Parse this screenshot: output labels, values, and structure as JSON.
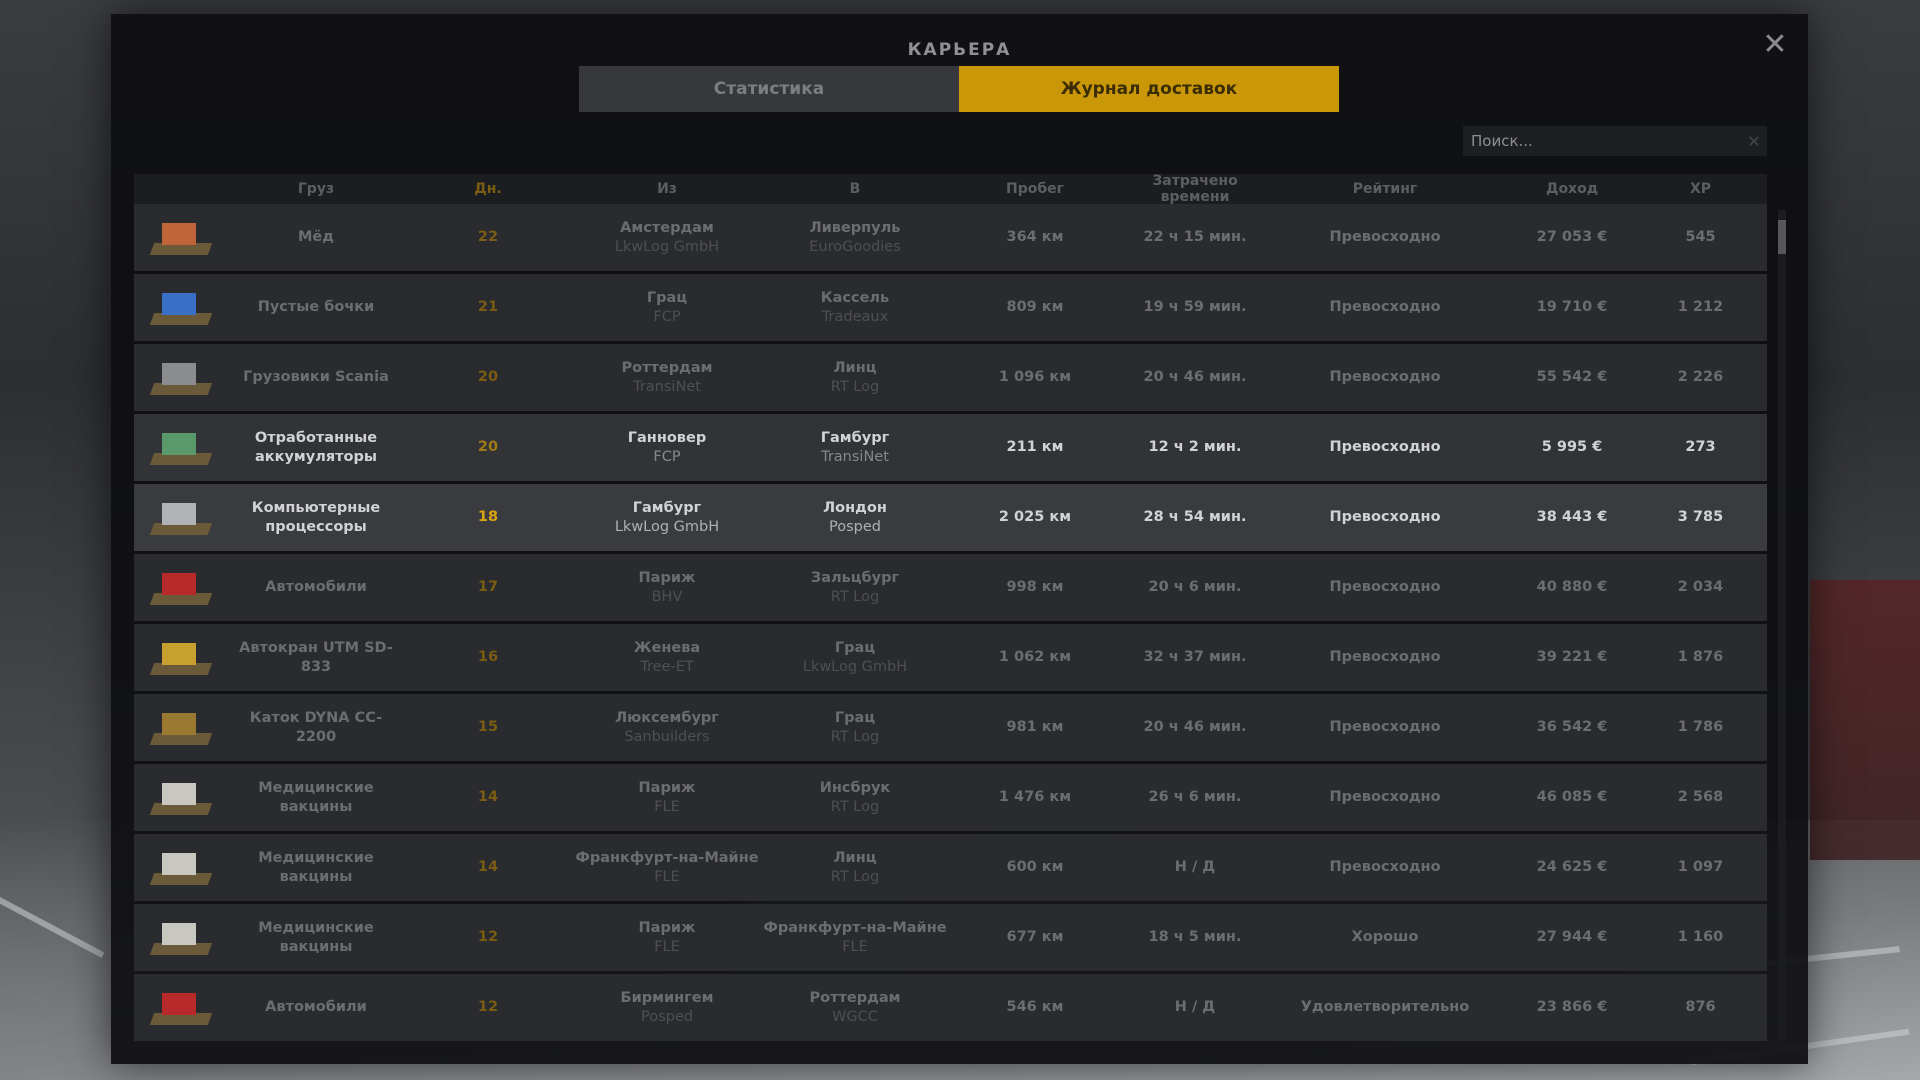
{
  "window": {
    "title": "КАРЬЕРА",
    "close_glyph": "✕"
  },
  "tabs": [
    {
      "label": "Статистика",
      "active": false
    },
    {
      "label": "Журнал доставок",
      "active": true
    }
  ],
  "search": {
    "placeholder": "Поиск...",
    "value": "",
    "clear_glyph": "✕"
  },
  "colors": {
    "accent": "#c99707",
    "days": "#d9a410",
    "panel": "#0e0e10"
  },
  "columns": [
    "Груз",
    "Дн.",
    "Из",
    "В",
    "Пробег",
    "Затрачено времени",
    "Рейтинг",
    "Доход",
    "XP"
  ],
  "rows": [
    {
      "icon": "honey-cargo-icon",
      "icon_color": "#c0653a",
      "cargo": "Мёд",
      "days": "22",
      "from_city": "Амстердам",
      "from_company": "LkwLog GmbH",
      "to_city": "Ливерпуль",
      "to_company": "EuroGoodies",
      "distance": "364 км",
      "time": "22 ч 15 мин.",
      "rating": "Превосходно",
      "income": "27 053 €",
      "xp": "545"
    },
    {
      "icon": "barrels-cargo-icon",
      "icon_color": "#3a6fc8",
      "cargo": "Пустые бочки",
      "days": "21",
      "from_city": "Грац",
      "from_company": "FCP",
      "to_city": "Кассель",
      "to_company": "Tradeaux",
      "distance": "809 км",
      "time": "19 ч 59 мин.",
      "rating": "Превосходно",
      "income": "19 710 €",
      "xp": "1 212"
    },
    {
      "icon": "truck-cargo-icon",
      "icon_color": "#8a8c90",
      "cargo": "Грузовики Scania",
      "days": "20",
      "from_city": "Роттердам",
      "from_company": "TransiNet",
      "to_city": "Линц",
      "to_company": "RT Log",
      "distance": "1 096 км",
      "time": "20 ч 46 мин.",
      "rating": "Превосходно",
      "income": "55 542 €",
      "xp": "2 226"
    },
    {
      "icon": "battery-cargo-icon",
      "icon_color": "#5a9a6a",
      "cargo": "Отработанные аккумуляторы",
      "days": "20",
      "from_city": "Ганновер",
      "from_company": "FCP",
      "to_city": "Гамбург",
      "to_company": "TransiNet",
      "distance": "211 км",
      "time": "12 ч 2 мин.",
      "rating": "Превосходно",
      "income": "5 995 €",
      "xp": "273"
    },
    {
      "icon": "computer-cargo-icon",
      "icon_color": "#b0b2b6",
      "cargo": "Компьютерные процессоры",
      "days": "18",
      "from_city": "Гамбург",
      "from_company": "LkwLog GmbH",
      "to_city": "Лондон",
      "to_company": "Posped",
      "distance": "2 025 км",
      "time": "28 ч 54 мин.",
      "rating": "Превосходно",
      "income": "38 443 €",
      "xp": "3 785"
    },
    {
      "icon": "car-cargo-icon",
      "icon_color": "#b82a2a",
      "cargo": "Автомобили",
      "days": "17",
      "from_city": "Париж",
      "from_company": "BHV",
      "to_city": "Зальцбург",
      "to_company": "RT Log",
      "distance": "998 км",
      "time": "20 ч 6 мин.",
      "rating": "Превосходно",
      "income": "40 880 €",
      "xp": "2 034"
    },
    {
      "icon": "crane-cargo-icon",
      "icon_color": "#c8a030",
      "cargo": "Автокран UTM SD-833",
      "days": "16",
      "from_city": "Женева",
      "from_company": "Tree-ET",
      "to_city": "Грац",
      "to_company": "LkwLog GmbH",
      "distance": "1 062 км",
      "time": "32 ч 37 мин.",
      "rating": "Превосходно",
      "income": "39 221 €",
      "xp": "1 876"
    },
    {
      "icon": "roller-cargo-icon",
      "icon_color": "#9a7a30",
      "cargo": "Каток DYNA CC-2200",
      "days": "15",
      "from_city": "Люксембург",
      "from_company": "Sanbuilders",
      "to_city": "Грац",
      "to_company": "RT Log",
      "distance": "981 км",
      "time": "20 ч 46 мин.",
      "rating": "Превосходно",
      "income": "36 542 €",
      "xp": "1 786"
    },
    {
      "icon": "vaccine-cargo-icon",
      "icon_color": "#c8c8c0",
      "cargo": "Медицинские вакцины",
      "days": "14",
      "from_city": "Париж",
      "from_company": "FLE",
      "to_city": "Инсбрук",
      "to_company": "RT Log",
      "distance": "1 476 км",
      "time": "26 ч 6 мин.",
      "rating": "Превосходно",
      "income": "46 085 €",
      "xp": "2 568"
    },
    {
      "icon": "vaccine-cargo-icon",
      "icon_color": "#c8c8c0",
      "cargo": "Медицинские вакцины",
      "days": "14",
      "from_city": "Франкфурт-на-Майне",
      "from_company": "FLE",
      "to_city": "Линц",
      "to_company": "RT Log",
      "distance": "600 км",
      "time": "Н / Д",
      "rating": "Превосходно",
      "income": "24 625 €",
      "xp": "1 097"
    },
    {
      "icon": "vaccine-cargo-icon",
      "icon_color": "#c8c8c0",
      "cargo": "Медицинские вакцины",
      "days": "12",
      "from_city": "Париж",
      "from_company": "FLE",
      "to_city": "Франкфурт-на-Майне",
      "to_company": "FLE",
      "distance": "677 км",
      "time": "18 ч 5 мин.",
      "rating": "Хорошо",
      "income": "27 944 €",
      "xp": "1 160"
    },
    {
      "icon": "car-cargo-icon",
      "icon_color": "#b82a2a",
      "cargo": "Автомобили",
      "days": "12",
      "from_city": "Бирмингем",
      "from_company": "Posped",
      "to_city": "Роттердам",
      "to_company": "WGCC",
      "distance": "546 км",
      "time": "Н / Д",
      "rating": "Удовлетворительно",
      "income": "23 866 €",
      "xp": "876"
    }
  ]
}
